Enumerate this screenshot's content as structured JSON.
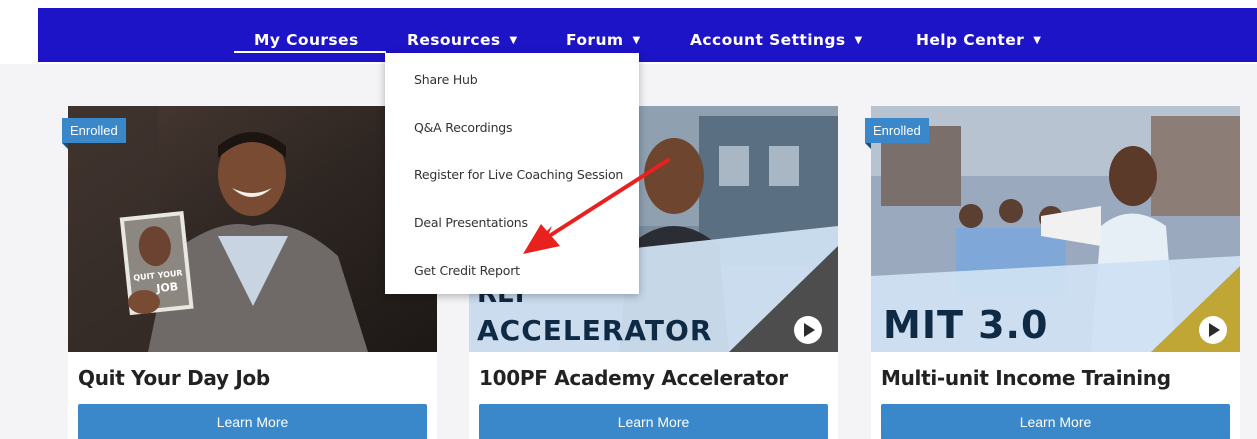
{
  "nav": {
    "items": [
      {
        "label": "My Courses",
        "has_caret": false,
        "active": true
      },
      {
        "label": "Resources",
        "has_caret": true,
        "active": false
      },
      {
        "label": "Forum",
        "has_caret": true,
        "active": false
      },
      {
        "label": "Account Settings",
        "has_caret": true,
        "active": false
      },
      {
        "label": "Help Center",
        "has_caret": true,
        "active": false
      }
    ],
    "caret_glyph": "▼"
  },
  "resources_dropdown": {
    "items": [
      {
        "label": "Share Hub"
      },
      {
        "label": "Q&A Recordings"
      },
      {
        "label": "Register for Live Coaching Session"
      },
      {
        "label": "Deal Presentations"
      },
      {
        "label": "Get Credit Report"
      }
    ]
  },
  "courses": [
    {
      "title": "Quit Your Day Job",
      "badge": "Enrolled",
      "button": "Learn More",
      "image_text": "",
      "book_text_top": "QUIT YOUR",
      "book_text_bottom": "JOB"
    },
    {
      "title": "100PF Academy Accelerator",
      "badge": "",
      "button": "Learn More",
      "image_text_line1": "REI",
      "image_text_line2": "ACCELERATOR"
    },
    {
      "title": "Multi-unit Income Training",
      "badge": "Enrolled",
      "button": "Learn More",
      "image_text_line1": "MIT 3.0"
    }
  ],
  "colors": {
    "nav_bg": "#1d13c7",
    "button_bg": "#3a87c9",
    "badge_bg": "#3a87c9",
    "arrow": "#e8211f",
    "page_bg": "#f4f4f6"
  }
}
